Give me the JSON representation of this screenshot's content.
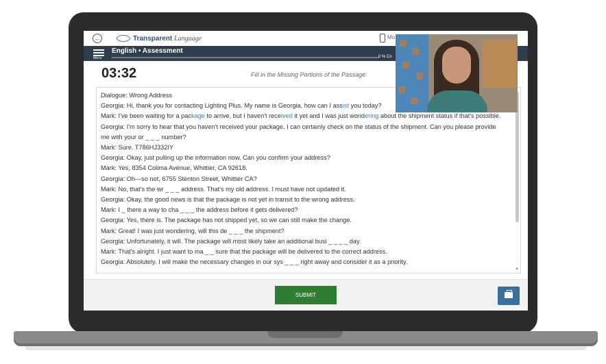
{
  "app": {
    "brand_main": "Transparent",
    "brand_script": "Language",
    "device_label": "Mo"
  },
  "header": {
    "menu_label": "Menu",
    "title": "English • Assessment",
    "progress_text": "0 % Co",
    "progress_fraction": 0
  },
  "activity": {
    "timer": "03:32",
    "instruction": "Fill in the Missing Portions of the Passage"
  },
  "passage": {
    "title": "Dialogue: Wrong Address",
    "lines": [
      [
        {
          "t": "Georgia: Hi, thank you for contacting Lighting Plus. My name is Georgia, how can I ass"
        },
        {
          "t": "ist",
          "hl": true
        },
        {
          "t": "  you today?"
        }
      ],
      [
        {
          "t": "Mark: I've been waiting for a pac"
        },
        {
          "t": "kage",
          "hl": true
        },
        {
          "t": "  to arrive, but I haven't rece"
        },
        {
          "t": "ived",
          "hl": true
        },
        {
          "t": "  it yet and I was just wond"
        },
        {
          "t": "ering",
          "hl": true
        },
        {
          "t": "  about the shipment status if that's possible."
        }
      ],
      [
        {
          "t": "Georgia: I'm sorry to hear that you haven't received your package. I can certainly check on the status of the shipment. Can you please provide me with your or _ _ _  number?"
        }
      ],
      [
        {
          "t": "Mark: Sure. T786HJ332IY"
        }
      ],
      [
        {
          "t": "Georgia: Okay, just pulling up the information now. Can you confirm your address?"
        }
      ],
      [
        {
          "t": "Mark: Yes, 8354 Colima Avenue, Whittier, CA 92618."
        }
      ],
      [
        {
          "t": "Georgia: Oh—so not, 6755 Stenton Street, Whittier CA?"
        }
      ],
      [
        {
          "t": "Mark: No, that's the wr _ _ _  address. That's my old address. I must have not updated it."
        }
      ],
      [
        {
          "t": "Georgia: Okay, the good news is that the package is not yet in transit to the wrong address."
        }
      ],
      [
        {
          "t": "Mark: I _  there a way to cha _ _ _  the address before it gets delivered?"
        }
      ],
      [
        {
          "t": "Georgia: Yes, there is. The package has not shipped yet, so we can still make the change."
        }
      ],
      [
        {
          "t": "Mark: Great! I was just wondering, will this de _ _ _  the shipment?"
        }
      ],
      [
        {
          "t": "Georgia: Unfortunately, it will. The package will most likely take an additional busi _ _ _ _  day."
        }
      ],
      [
        {
          "t": "Mark: That's alright. I just want to ma _ _  sure that the package will be delivered to the correct address."
        }
      ],
      [
        {
          "t": "Georgia: Absolutely. I will make the necessary changes in our sys _ _ _  right away and consider it as a priority."
        }
      ]
    ]
  },
  "footer": {
    "submit_label": "SUBMIT"
  },
  "colors": {
    "header_bg": "#2f3e4e",
    "submit_green": "#2e7d32",
    "highlight_blue": "#3a7ecf",
    "kit_button": "#3d6e9c"
  }
}
